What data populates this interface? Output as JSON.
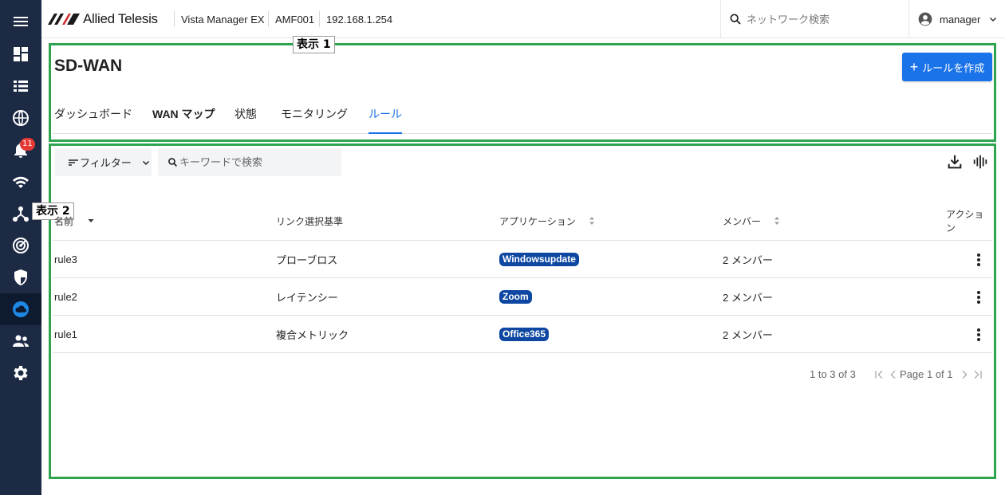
{
  "header": {
    "brand": "Allied Telesis",
    "app_name": "Vista Manager EX",
    "device": "AMF001",
    "ip": "192.168.1.254",
    "search_placeholder": "ネットワーク検索",
    "user": "manager"
  },
  "sidebar": {
    "items": [
      {
        "name": "menu",
        "icon": "menu-icon"
      },
      {
        "name": "dashboard",
        "icon": "dashboard-icon"
      },
      {
        "name": "list",
        "icon": "list-icon"
      },
      {
        "name": "globe",
        "icon": "globe-icon"
      },
      {
        "name": "alerts",
        "icon": "bell-icon",
        "badge": "11"
      },
      {
        "name": "wireless",
        "icon": "wifi-icon"
      },
      {
        "name": "topology",
        "icon": "topology-icon"
      },
      {
        "name": "radar",
        "icon": "radar-icon"
      },
      {
        "name": "security",
        "icon": "shield-icon"
      },
      {
        "name": "sdwan",
        "icon": "cloud-icon",
        "active": true
      },
      {
        "name": "users",
        "icon": "users-icon"
      },
      {
        "name": "settings",
        "icon": "gear-icon"
      }
    ]
  },
  "annotations": {
    "box1": "表示 1",
    "box2": "表示 2"
  },
  "page": {
    "title": "SD-WAN",
    "create_button": "ルールを作成",
    "tabs": [
      {
        "label": "ダッシュボード"
      },
      {
        "label": "WAN マップ"
      },
      {
        "label": "状態"
      },
      {
        "label": "モニタリング"
      },
      {
        "label": "ルール",
        "active": true
      }
    ]
  },
  "toolbar": {
    "filter_label": "フィルター",
    "search_placeholder": "キーワードで検索"
  },
  "table": {
    "columns": [
      "名前",
      "リンク選択基準",
      "アプリケーション",
      "メンバー",
      "アクション"
    ],
    "rows": [
      {
        "name": "rule3",
        "criteria": "プローブロス",
        "app": "Windowsupdate",
        "members": "2 メンバー"
      },
      {
        "name": "rule2",
        "criteria": "レイテンシー",
        "app": "Zoom",
        "members": "2 メンバー"
      },
      {
        "name": "rule1",
        "criteria": "複合メトリック",
        "app": "Office365",
        "members": "2 メンバー"
      }
    ]
  },
  "pagination": {
    "range": "1 to 3 of 3",
    "page": "Page 1 of 1"
  },
  "colors": {
    "sidebar_bg": "#1c2a44",
    "accent": "#1a73e8",
    "chip": "#0d47a1",
    "annotation_border": "#2ea44f"
  }
}
